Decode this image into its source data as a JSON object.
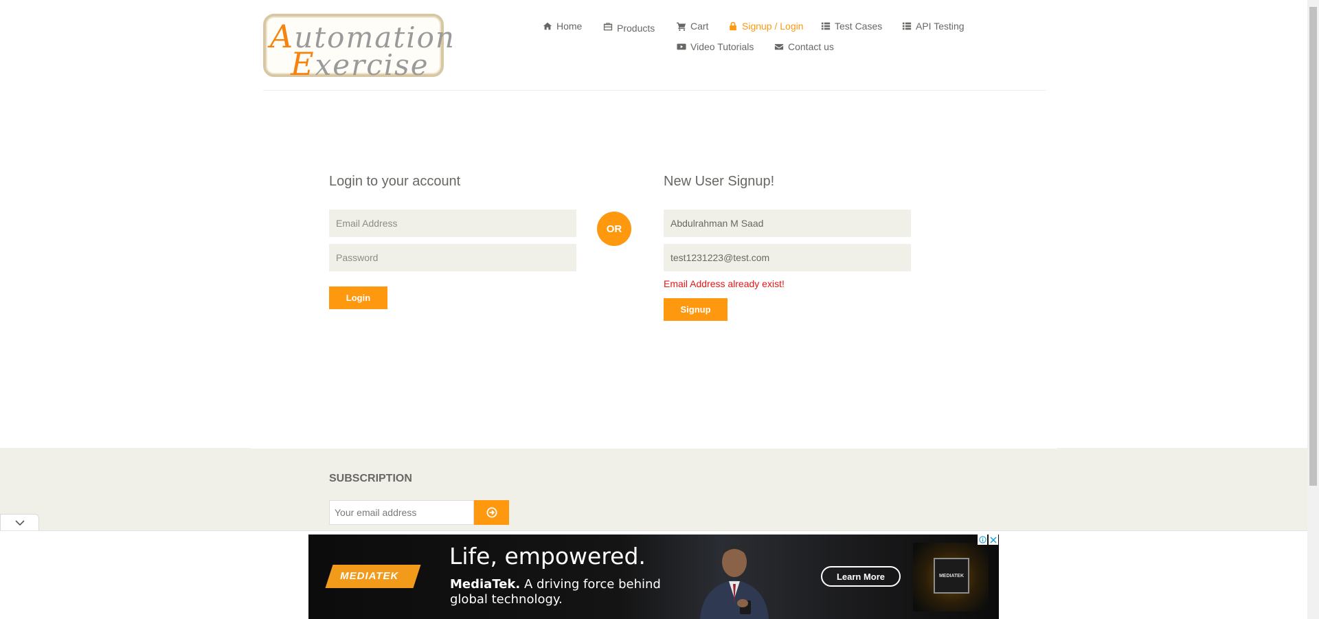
{
  "logo": {
    "line1_cap": "A",
    "line1_rest": "utomation",
    "line2_cap": "E",
    "line2_rest": "xercise"
  },
  "nav": {
    "home": "Home",
    "products": "Products",
    "cart": "Cart",
    "signup_login": "Signup / Login",
    "test_cases": "Test Cases",
    "api_testing": "API Testing",
    "video_tutorials": "Video Tutorials",
    "contact_us": "Contact us"
  },
  "login": {
    "title": "Login to your account",
    "email_placeholder": "Email Address",
    "password_placeholder": "Password",
    "button": "Login"
  },
  "or_label": "OR",
  "signup": {
    "title": "New User Signup!",
    "name_value": "Abdulrahman M Saad",
    "email_value": "test1231223@test.com",
    "error": "Email Address already exist!",
    "button": "Signup"
  },
  "subscription": {
    "title": "SUBSCRIPTION",
    "placeholder": "Your email address"
  },
  "ad": {
    "brand": "MEDIATEK",
    "headline": "Life, empowered.",
    "sub_brand": "MediaTek.",
    "sub_text": "A driving force behind global technology.",
    "cta": "Learn More",
    "chip_label": "MEDIATEK"
  },
  "colors": {
    "accent": "#fe980f",
    "error": "#e51616",
    "field_bg": "#f0f0e9",
    "text": "#696763"
  }
}
